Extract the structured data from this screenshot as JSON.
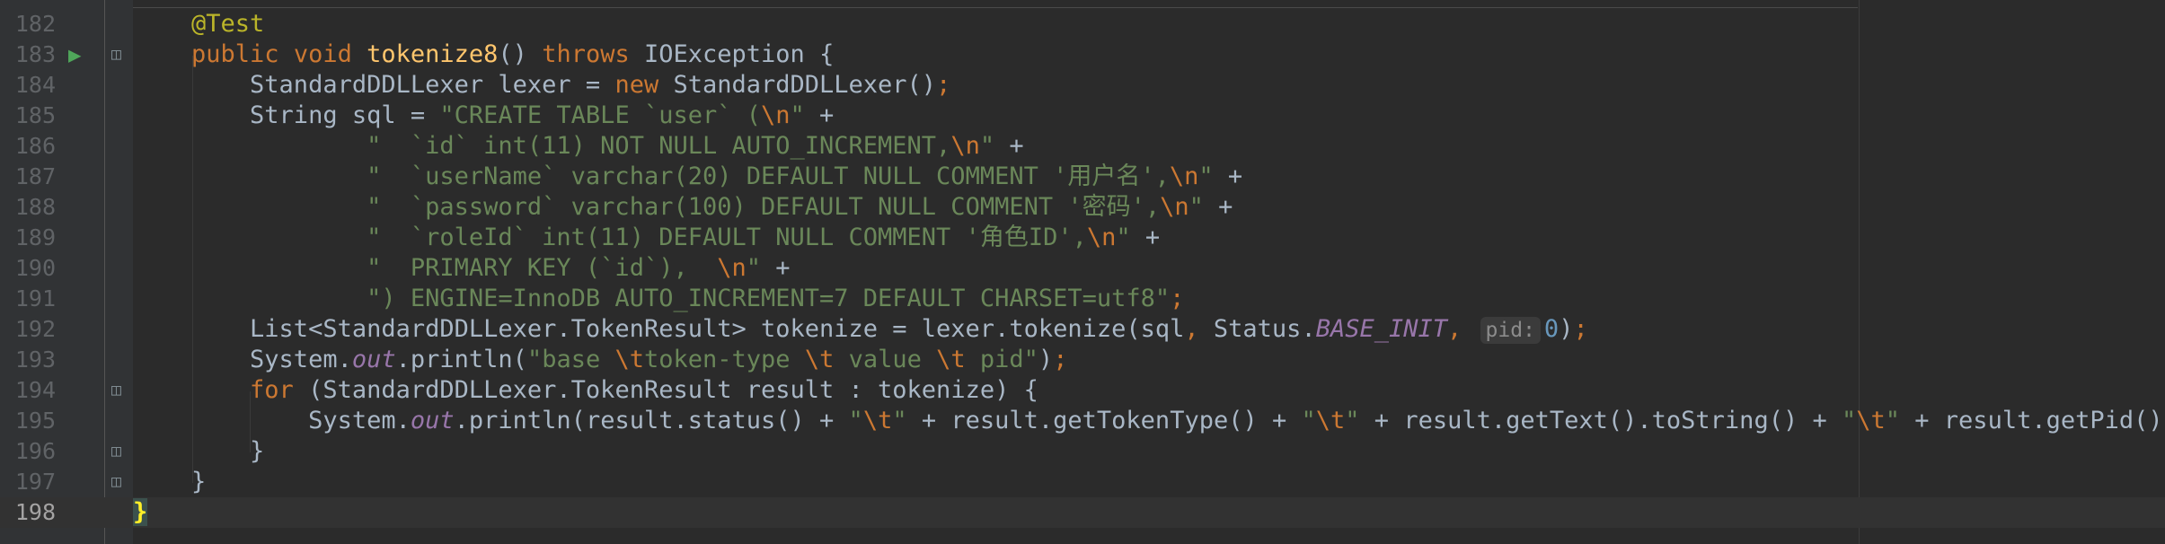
{
  "editor": {
    "lines": [
      {
        "n": "182",
        "tokens": [
          {
            "t": "    "
          },
          {
            "t": "@Test",
            "c": "ann"
          }
        ]
      },
      {
        "n": "183",
        "tokens": [
          {
            "t": "    "
          },
          {
            "t": "public void ",
            "c": "kw"
          },
          {
            "t": "tokenize8",
            "c": "fn"
          },
          {
            "t": "() "
          },
          {
            "t": "throws ",
            "c": "kw"
          },
          {
            "t": "IOException {"
          }
        ]
      },
      {
        "n": "184",
        "tokens": [
          {
            "t": "        StandardDDLLexer lexer = "
          },
          {
            "t": "new ",
            "c": "kw"
          },
          {
            "t": "StandardDDLLexer()"
          },
          {
            "t": ";",
            "c": "kw"
          }
        ]
      },
      {
        "n": "185",
        "tokens": [
          {
            "t": "        String sql = "
          },
          {
            "t": "\"CREATE TABLE `user` (",
            "c": "str"
          },
          {
            "t": "\\n",
            "c": "esc"
          },
          {
            "t": "\"",
            "c": "str"
          },
          {
            "t": " +"
          }
        ]
      },
      {
        "n": "186",
        "tokens": [
          {
            "t": "                "
          },
          {
            "t": "\"  `id` int(11) NOT NULL AUTO_INCREMENT,",
            "c": "str"
          },
          {
            "t": "\\n",
            "c": "esc"
          },
          {
            "t": "\"",
            "c": "str"
          },
          {
            "t": " +"
          }
        ]
      },
      {
        "n": "187",
        "tokens": [
          {
            "t": "                "
          },
          {
            "t": "\"  `userName` varchar(20) DEFAULT NULL COMMENT '用户名',",
            "c": "str"
          },
          {
            "t": "\\n",
            "c": "esc"
          },
          {
            "t": "\"",
            "c": "str"
          },
          {
            "t": " +"
          }
        ]
      },
      {
        "n": "188",
        "tokens": [
          {
            "t": "                "
          },
          {
            "t": "\"  `password` varchar(100) DEFAULT NULL COMMENT '密码',",
            "c": "str"
          },
          {
            "t": "\\n",
            "c": "esc"
          },
          {
            "t": "\"",
            "c": "str"
          },
          {
            "t": " +"
          }
        ]
      },
      {
        "n": "189",
        "tokens": [
          {
            "t": "                "
          },
          {
            "t": "\"  `roleId` int(11) DEFAULT NULL COMMENT '角色ID',",
            "c": "str"
          },
          {
            "t": "\\n",
            "c": "esc"
          },
          {
            "t": "\"",
            "c": "str"
          },
          {
            "t": " +"
          }
        ]
      },
      {
        "n": "190",
        "tokens": [
          {
            "t": "                "
          },
          {
            "t": "\"  PRIMARY KEY (`id`),  ",
            "c": "str"
          },
          {
            "t": "\\n",
            "c": "esc"
          },
          {
            "t": "\"",
            "c": "str"
          },
          {
            "t": " +"
          }
        ]
      },
      {
        "n": "191",
        "tokens": [
          {
            "t": "                "
          },
          {
            "t": "\") ENGINE=InnoDB AUTO_INCREMENT=7 DEFAULT CHARSET=utf8\"",
            "c": "str"
          },
          {
            "t": ";",
            "c": "kw"
          }
        ]
      },
      {
        "n": "192",
        "tokens": [
          {
            "t": "        List<StandardDDLLexer.TokenResult> tokenize = lexer.tokenize(sql"
          },
          {
            "t": ", ",
            "c": "kw"
          },
          {
            "t": "Status."
          },
          {
            "t": "BASE_INIT",
            "c": "static"
          },
          {
            "t": ", ",
            "c": "kw"
          },
          {
            "hint": "pid:"
          },
          {
            "t": "0",
            "c": "num"
          },
          {
            "t": ")"
          },
          {
            "t": ";",
            "c": "kw"
          }
        ]
      },
      {
        "n": "193",
        "tokens": [
          {
            "t": "        System."
          },
          {
            "t": "out",
            "c": "static"
          },
          {
            "t": ".println("
          },
          {
            "t": "\"base ",
            "c": "str"
          },
          {
            "t": "\\t",
            "c": "esc"
          },
          {
            "t": "token-type ",
            "c": "str"
          },
          {
            "t": "\\t",
            "c": "esc"
          },
          {
            "t": " value ",
            "c": "str"
          },
          {
            "t": "\\t",
            "c": "esc"
          },
          {
            "t": " pid\"",
            "c": "str"
          },
          {
            "t": ")"
          },
          {
            "t": ";",
            "c": "kw"
          }
        ]
      },
      {
        "n": "194",
        "tokens": [
          {
            "t": "        "
          },
          {
            "t": "for ",
            "c": "kw"
          },
          {
            "t": "(StandardDDLLexer.TokenResult result : tokenize) {"
          }
        ]
      },
      {
        "n": "195",
        "tokens": [
          {
            "t": "            System."
          },
          {
            "t": "out",
            "c": "static"
          },
          {
            "t": ".println(result.status() + "
          },
          {
            "t": "\"",
            "c": "str"
          },
          {
            "t": "\\t",
            "c": "esc"
          },
          {
            "t": "\"",
            "c": "str"
          },
          {
            "t": " + result.getTokenType() + "
          },
          {
            "t": "\"",
            "c": "str"
          },
          {
            "t": "\\t",
            "c": "esc"
          },
          {
            "t": "\"",
            "c": "str"
          },
          {
            "t": " + result.getText().toString() + "
          },
          {
            "t": "\"",
            "c": "str"
          },
          {
            "t": "\\t",
            "c": "esc"
          },
          {
            "t": "\"",
            "c": "str"
          },
          {
            "t": " + result.getPid())"
          },
          {
            "t": ";",
            "c": "kw"
          }
        ]
      },
      {
        "n": "196",
        "tokens": [
          {
            "t": "        }"
          }
        ]
      },
      {
        "n": "197",
        "tokens": [
          {
            "t": "    }"
          }
        ]
      },
      {
        "n": "198",
        "tokens": [
          {
            "t": "}",
            "c": "brace-match"
          }
        ],
        "current": true
      }
    ]
  },
  "icons": {
    "run": "run-test-icon",
    "fold": "fold-marker-icon"
  }
}
